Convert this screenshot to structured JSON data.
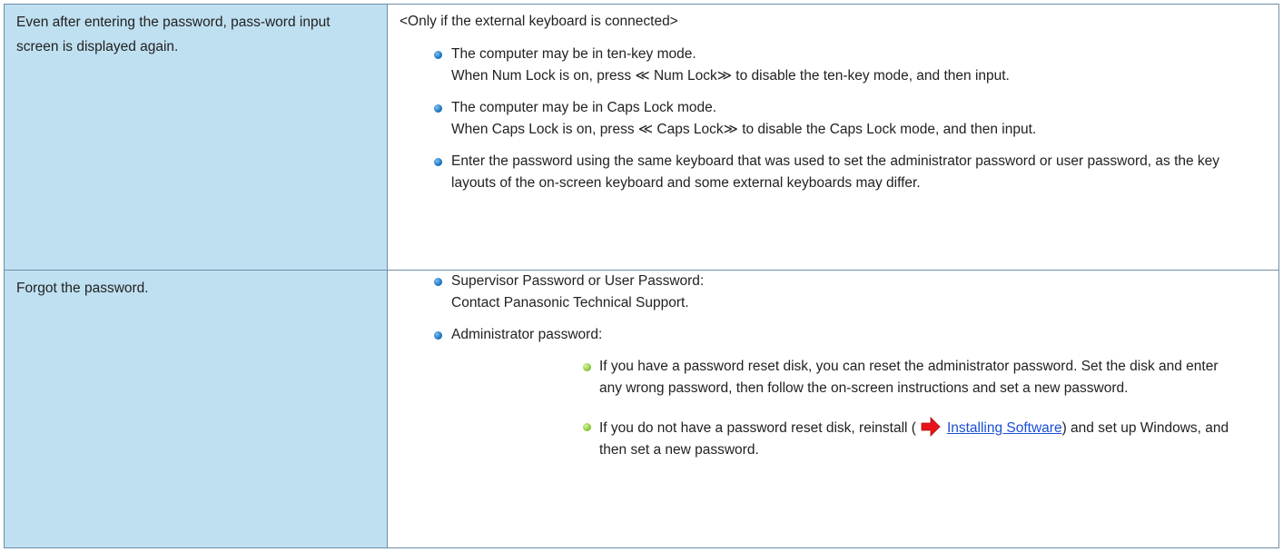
{
  "rows": [
    {
      "problem": "Even after entering the password, pass-word input screen is displayed again.",
      "note": "<Only if the external keyboard is connected>",
      "items": [
        {
          "line1": "The computer may be in ten-key mode.",
          "line2": "When Num Lock is on, press ≪ Num Lock≫ to disable the ten-key mode, and then input."
        },
        {
          "line1": "The computer may be in Caps Lock mode.",
          "line2": "When Caps Lock is on, press ≪ Caps Lock≫ to disable the Caps Lock mode, and then input."
        },
        {
          "text": "Enter the password using the same keyboard that was used to set the administrator password or user password, as the key layouts of the on-screen keyboard and some external keyboards may differ."
        }
      ]
    },
    {
      "problem": "Forgot the password.",
      "items": [
        {
          "line1": "Supervisor Password or User Password:",
          "line2": "Contact Panasonic Technical Support."
        },
        {
          "line1": "Administrator password:",
          "subitems": [
            {
              "text": "If you have a password reset disk, you can reset the administrator password. Set the disk and enter any wrong password, then follow the on-screen instructions and set a new password."
            },
            {
              "before": "If you do not have a password reset disk, reinstall (",
              "link": "Installing Software",
              "after": ") and set up Windows, and then set a new password.",
              "icon": "red-arrow-icon"
            }
          ]
        }
      ]
    }
  ],
  "colors": {
    "problem_bg": "#bfe0f1",
    "border": "#6f8fa8",
    "link": "#1a4fd6",
    "bullet": "#1d74c4",
    "sub_bullet": "#8ccc3a",
    "arrow": "#e8141b"
  }
}
